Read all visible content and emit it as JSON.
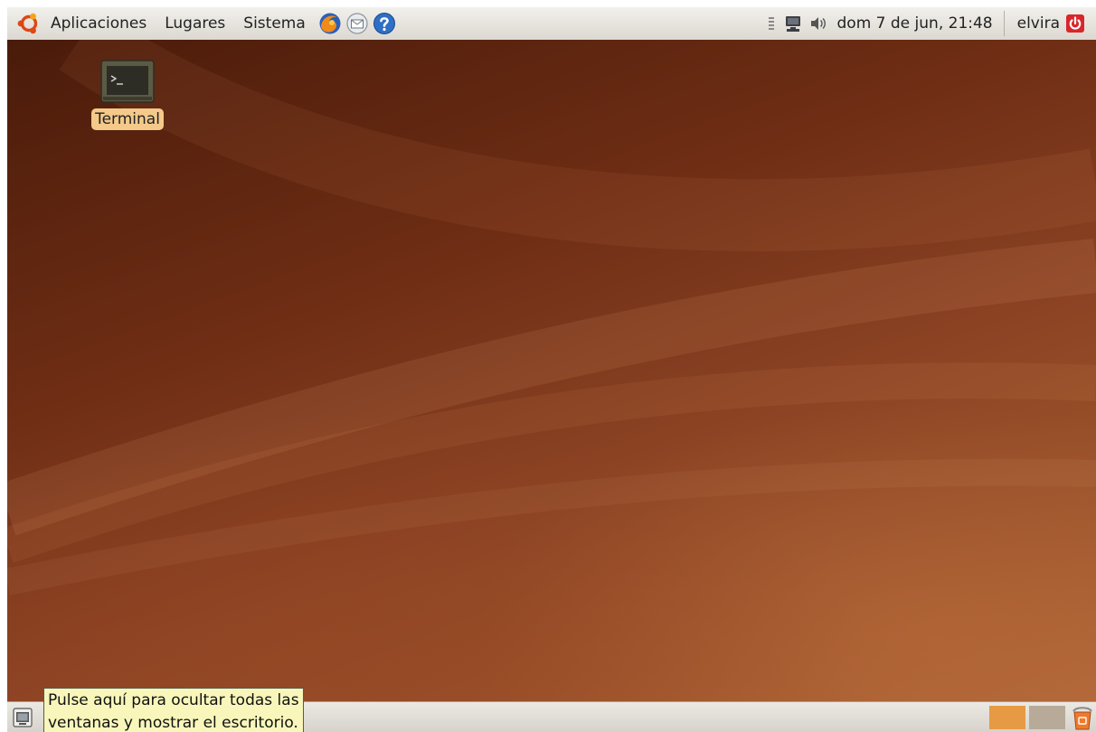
{
  "top_panel": {
    "menus": [
      "Aplicaciones",
      "Lugares",
      "Sistema"
    ],
    "launchers": [
      "firefox-icon",
      "mail-icon",
      "help-icon"
    ],
    "clock": "dom  7 de jun, 21:48",
    "user": "elvira",
    "tray_icons": [
      "network-icon",
      "volume-icon"
    ]
  },
  "desktop": {
    "icons": [
      {
        "label": "Terminal",
        "icon": "terminal-icon"
      }
    ]
  },
  "bottom_panel": {
    "tooltip_lines": [
      "Pulse aquí para ocultar todas las",
      "ventanas y mostrar el escritorio."
    ],
    "workspaces": [
      "active",
      "inactive"
    ]
  },
  "colors": {
    "accent": "#e79a44",
    "desktop_dark": "#4a1b0a",
    "desktop_light": "#b0673a",
    "tooltip_bg": "#f8f6ba"
  }
}
